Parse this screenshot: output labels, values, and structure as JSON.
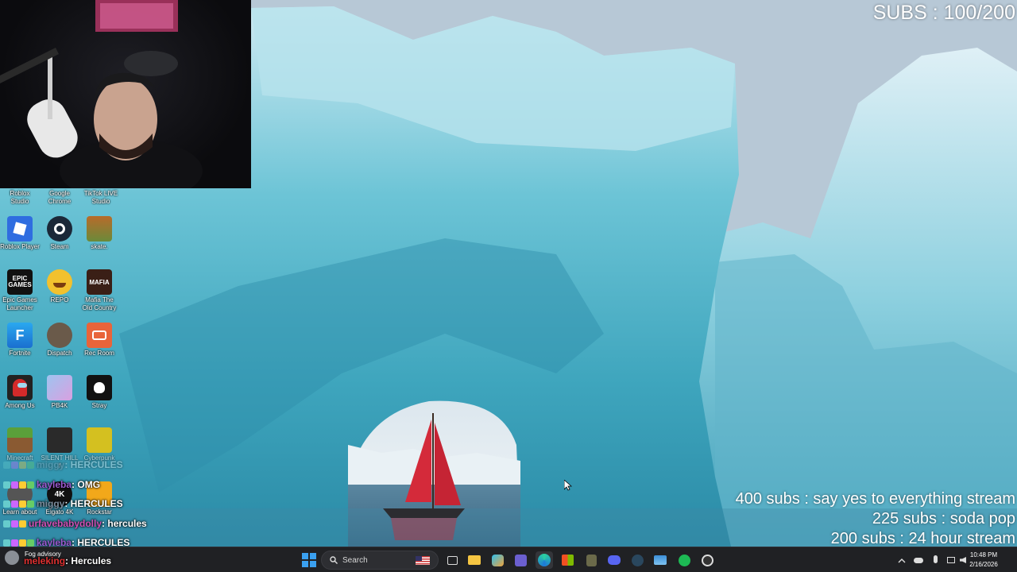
{
  "overlay": {
    "subs_counter": "SUBS : 100/200",
    "goals": [
      "400 subs :  say yes to everything stream",
      "225 subs : soda pop",
      "200 subs : 24 hour stream"
    ]
  },
  "desktop": {
    "icons": [
      {
        "label": "Roblox\nStudio",
        "name": "roblox-studio-icon"
      },
      {
        "label": "Google\nChrome",
        "name": "google-chrome-icon"
      },
      {
        "label": "TikTok LIVE\nStudio",
        "name": "tiktok-live-studio-icon"
      },
      {
        "label": "Roblox Player",
        "name": "roblox-player-icon"
      },
      {
        "label": "Steam",
        "name": "steam-icon"
      },
      {
        "label": "skate.",
        "name": "skate-icon"
      },
      {
        "label": "Epic Games\nLauncher",
        "name": "epic-games-icon"
      },
      {
        "label": "REPO",
        "name": "repo-icon"
      },
      {
        "label": "Mafia The\nOld Country",
        "name": "mafia-icon"
      },
      {
        "label": "Fortnite",
        "name": "fortnite-icon"
      },
      {
        "label": "Dispatch",
        "name": "dispatch-icon"
      },
      {
        "label": "Rec Room",
        "name": "rec-room-icon"
      },
      {
        "label": "Among Us",
        "name": "among-us-icon"
      },
      {
        "label": "PB4K",
        "name": "pb4k-icon"
      },
      {
        "label": "Stray",
        "name": "stray-icon"
      },
      {
        "label": "Minecraft",
        "name": "minecraft-icon"
      },
      {
        "label": "SILENT HILL f",
        "name": "silent-hill-icon"
      },
      {
        "label": "Cyberpunk",
        "name": "cyberpunk-icon"
      },
      {
        "label": "Learn about",
        "name": "learn-about-icon"
      },
      {
        "label": "Elgato 4K",
        "name": "elgato-4k-icon"
      },
      {
        "label": "Rockstar",
        "name": "rockstar-icon"
      }
    ],
    "icon_art": {
      "epic": "EPIC GAMES",
      "mafia": "MAFIA",
      "fortnite": "F",
      "elgato": "4K"
    }
  },
  "chat": [
    {
      "user": "miggy",
      "message": ": HERCULES",
      "user_color": "#7b8b9b",
      "faded": true
    },
    {
      "user": "kayleba",
      "message": ": OMG",
      "user_color": "#9b59d0",
      "faded": false
    },
    {
      "user": "miggy",
      "message": ": HERCULES",
      "user_color": "#7b8b9b",
      "faded": false
    },
    {
      "user": "urfavebabydolly",
      "message": " : hercules",
      "user_color": "#d04fb5",
      "faded": false
    },
    {
      "user": "kayleba",
      "message": ": HERCULES",
      "user_color": "#9b59d0",
      "faded": false
    },
    {
      "user": "meleking",
      "message": ": Hercules",
      "user_color": "#e03030",
      "faded": false
    }
  ],
  "taskbar": {
    "weather": "Fog advisory",
    "search_placeholder": "Search",
    "time": "10:48 PM",
    "date": "2/16/2026"
  },
  "colors": {
    "taskbar_bg": "#202124",
    "ice": "#4fb5c8",
    "sail": "#d42a3a"
  }
}
